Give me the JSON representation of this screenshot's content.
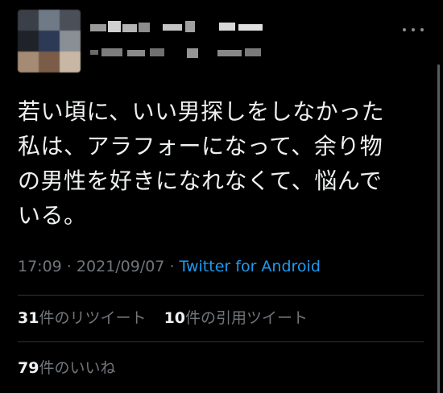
{
  "tweet": {
    "text": "若い頃に、いい男探しをしなかった\n私は、アラフォーになって、余り物\nの男性を好きになれなくて、悩んで\nいる。",
    "time": "17:09",
    "separator_1": " · ",
    "date": "2021/09/07",
    "separator_2": " · ",
    "source": "Twitter for Android"
  },
  "stats": {
    "retweets_count": "31",
    "retweets_label": "件のリツイート",
    "quotes_count": "10",
    "quotes_label": "件の引用ツイート",
    "likes_count": "79",
    "likes_label": "件のいいね"
  },
  "colors": {
    "background": "#000000",
    "text": "#eef0f1",
    "muted": "#71767b",
    "link": "#1d9bf0",
    "divider": "#2f3336"
  },
  "icons": {
    "more": "more-horizontal-icon"
  }
}
